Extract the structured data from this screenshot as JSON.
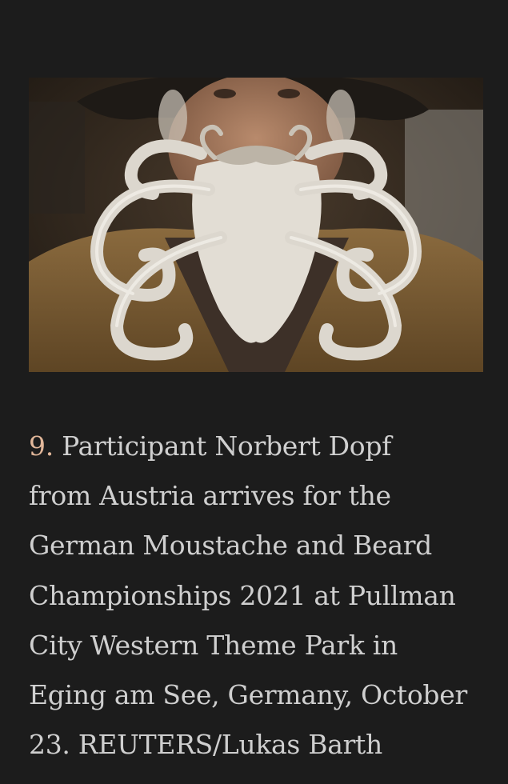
{
  "article": {
    "photo": {
      "icon": "photo-image"
    },
    "caption": {
      "number": "9.",
      "lines": [
        "Participant Norbert Dopf",
        "from Austria arrives for the",
        "German Moustache and Beard",
        "Championships 2021 at Pullman",
        "City Western Theme Park in",
        "Eging am See, Germany, October",
        "23. REUTERS/Lukas Barth"
      ]
    },
    "colors": {
      "background": "#1c1c1c",
      "caption_text": "#cfcfcf",
      "caption_number": "#e2b79a"
    }
  }
}
